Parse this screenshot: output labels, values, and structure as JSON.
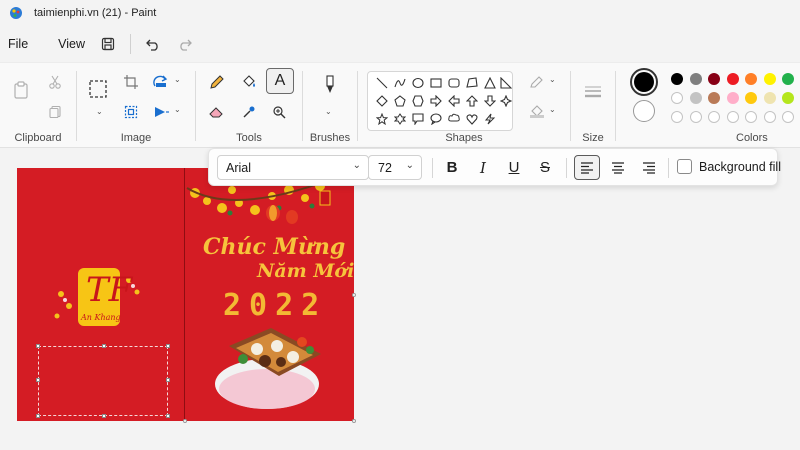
{
  "window": {
    "title": "taimienphi.vn (21) - Paint"
  },
  "menu": {
    "file": "File",
    "view": "View"
  },
  "ribbon": {
    "groups": {
      "clipboard": "Clipboard",
      "image": "Image",
      "tools": "Tools",
      "brushes": "Brushes",
      "shapes": "Shapes",
      "size": "Size",
      "colors": "Colors"
    }
  },
  "colors": {
    "primary": "#000000",
    "secondary": "#ffffff",
    "palette_row1": [
      "#000000",
      "#7f7f7f",
      "#880015",
      "#ed1c24",
      "#ff7f27",
      "#fff200",
      "#22b14c"
    ],
    "palette_row2": [
      "#ffffff",
      "#c3c3c3",
      "#b97a57",
      "#ffaec9",
      "#ffc90e",
      "#efe4b0",
      "#b5e61d"
    ]
  },
  "text_toolbar": {
    "font": "Arial",
    "size": "72",
    "bold": "B",
    "italic": "I",
    "underline": "U",
    "strike": "S",
    "background_fill": "Background fill"
  },
  "image": {
    "logo_glyph": "TF",
    "logo_caption": "An Khang",
    "greeting_line1": "Chúc Mừng",
    "greeting_line2": "Năm Mới",
    "year": "2022"
  }
}
